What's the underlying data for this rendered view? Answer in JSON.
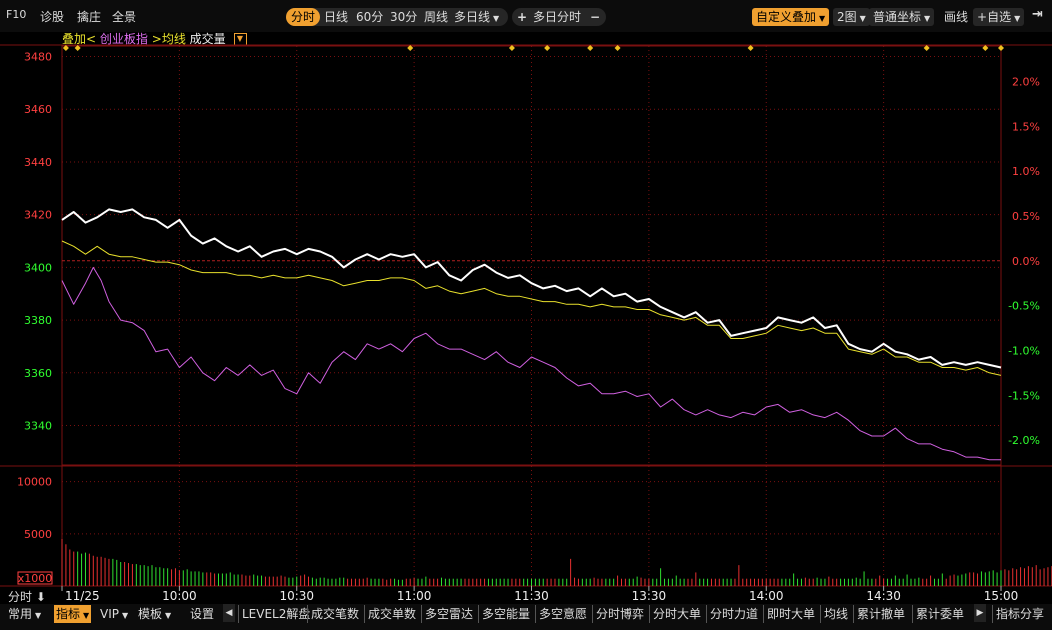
{
  "toolbar": {
    "left": [
      "F10",
      "诊股",
      "擒庄",
      "全景"
    ],
    "period_tabs": [
      "分时",
      "日线",
      "60分",
      "30分",
      "周线",
      "多日线"
    ],
    "multiday_label": "多日分时",
    "custom_overlay": "自定义叠加",
    "charts_count": "2图",
    "coord_mode": "普通坐标",
    "draw_label": "画线",
    "watchlist": "自选"
  },
  "overlay": {
    "label": "叠加",
    "open": "<",
    "index": "创业板指",
    "close": ">",
    "avg": "均线",
    "volume": "成交量"
  },
  "colors": {
    "bg": "#000000",
    "grid": "#7a1010",
    "price": "#ffffff",
    "avg": "#e8e02c",
    "overlay": "#d060e0",
    "up": "#ff4040",
    "down": "#30ff30",
    "active": "#f0a030"
  },
  "chart_data": {
    "type": "line",
    "left_ticks": [
      3480,
      3460,
      3440,
      3420,
      3400,
      3380,
      3360,
      3340
    ],
    "right_ticks": [
      "2.0%",
      "1.5%",
      "1.0%",
      "0.5%",
      "0.0%",
      "-0.5%",
      "-1.0%",
      "-1.5%",
      "-2.0%"
    ],
    "ylim": [
      3325,
      3484
    ],
    "base": 3402.5,
    "x_labels": [
      "11/25",
      "10:00",
      "10:30",
      "11:00",
      "11:30",
      "13:30",
      "14:00",
      "14:30",
      "15:00"
    ],
    "x_minutes": [
      0,
      30,
      60,
      90,
      120,
      150,
      180,
      210,
      240
    ],
    "markers": [
      1,
      4,
      89,
      115,
      124,
      135,
      142,
      176,
      221,
      236,
      240
    ],
    "series": [
      {
        "key": "price",
        "points": [
          [
            0,
            3418
          ],
          [
            3,
            3421
          ],
          [
            6,
            3417
          ],
          [
            9,
            3419
          ],
          [
            12,
            3422
          ],
          [
            15,
            3421
          ],
          [
            18,
            3422
          ],
          [
            21,
            3419
          ],
          [
            24,
            3418
          ],
          [
            27,
            3415
          ],
          [
            30,
            3418
          ],
          [
            33,
            3412
          ],
          [
            36,
            3409
          ],
          [
            39,
            3411
          ],
          [
            42,
            3408
          ],
          [
            45,
            3406
          ],
          [
            48,
            3408
          ],
          [
            51,
            3404
          ],
          [
            54,
            3406
          ],
          [
            57,
            3407
          ],
          [
            60,
            3405
          ],
          [
            63,
            3407
          ],
          [
            66,
            3406
          ],
          [
            69,
            3404
          ],
          [
            72,
            3400
          ],
          [
            75,
            3403
          ],
          [
            78,
            3405
          ],
          [
            81,
            3403
          ],
          [
            84,
            3405
          ],
          [
            87,
            3404
          ],
          [
            90,
            3405
          ],
          [
            93,
            3400
          ],
          [
            96,
            3402
          ],
          [
            99,
            3397
          ],
          [
            102,
            3395
          ],
          [
            105,
            3399
          ],
          [
            108,
            3401
          ],
          [
            111,
            3398
          ],
          [
            114,
            3396
          ],
          [
            117,
            3397
          ],
          [
            120,
            3394
          ],
          [
            123,
            3392
          ],
          [
            126,
            3393
          ],
          [
            129,
            3391
          ],
          [
            132,
            3392
          ],
          [
            135,
            3389
          ],
          [
            138,
            3392
          ],
          [
            141,
            3389
          ],
          [
            144,
            3390
          ],
          [
            147,
            3387
          ],
          [
            150,
            3388
          ],
          [
            153,
            3385
          ],
          [
            156,
            3383
          ],
          [
            159,
            3381
          ],
          [
            162,
            3383
          ],
          [
            165,
            3379
          ],
          [
            168,
            3380
          ],
          [
            171,
            3374
          ],
          [
            174,
            3375
          ],
          [
            177,
            3376
          ],
          [
            180,
            3377
          ],
          [
            183,
            3381
          ],
          [
            186,
            3380
          ],
          [
            189,
            3379
          ],
          [
            192,
            3381
          ],
          [
            195,
            3377
          ],
          [
            198,
            3378
          ],
          [
            201,
            3371
          ],
          [
            204,
            3369
          ],
          [
            207,
            3368
          ],
          [
            210,
            3371
          ],
          [
            213,
            3368
          ],
          [
            216,
            3367
          ],
          [
            219,
            3365
          ],
          [
            222,
            3366
          ],
          [
            225,
            3363
          ],
          [
            228,
            3364
          ],
          [
            231,
            3363
          ],
          [
            234,
            3364
          ],
          [
            237,
            3363
          ],
          [
            240,
            3362
          ]
        ]
      },
      {
        "key": "avg",
        "points": [
          [
            0,
            3410
          ],
          [
            3,
            3408
          ],
          [
            6,
            3405
          ],
          [
            9,
            3408
          ],
          [
            12,
            3405
          ],
          [
            15,
            3404
          ],
          [
            18,
            3404
          ],
          [
            21,
            3403
          ],
          [
            24,
            3402
          ],
          [
            27,
            3402
          ],
          [
            30,
            3401
          ],
          [
            33,
            3399
          ],
          [
            36,
            3398
          ],
          [
            39,
            3398
          ],
          [
            42,
            3398
          ],
          [
            45,
            3397
          ],
          [
            48,
            3397
          ],
          [
            51,
            3396
          ],
          [
            54,
            3397
          ],
          [
            57,
            3396
          ],
          [
            60,
            3396
          ],
          [
            63,
            3397
          ],
          [
            66,
            3396
          ],
          [
            69,
            3395
          ],
          [
            72,
            3393
          ],
          [
            75,
            3394
          ],
          [
            78,
            3395
          ],
          [
            81,
            3395
          ],
          [
            84,
            3396
          ],
          [
            87,
            3396
          ],
          [
            90,
            3395
          ],
          [
            93,
            3392
          ],
          [
            96,
            3393
          ],
          [
            99,
            3391
          ],
          [
            102,
            3390
          ],
          [
            105,
            3391
          ],
          [
            108,
            3392
          ],
          [
            111,
            3390
          ],
          [
            114,
            3389
          ],
          [
            117,
            3389
          ],
          [
            120,
            3388
          ],
          [
            123,
            3387
          ],
          [
            126,
            3387
          ],
          [
            129,
            3386
          ],
          [
            132,
            3386
          ],
          [
            135,
            3385
          ],
          [
            138,
            3386
          ],
          [
            141,
            3385
          ],
          [
            144,
            3385
          ],
          [
            147,
            3384
          ],
          [
            150,
            3384
          ],
          [
            153,
            3382
          ],
          [
            156,
            3381
          ],
          [
            159,
            3380
          ],
          [
            162,
            3381
          ],
          [
            165,
            3378
          ],
          [
            168,
            3378
          ],
          [
            171,
            3373
          ],
          [
            174,
            3373
          ],
          [
            177,
            3374
          ],
          [
            180,
            3375
          ],
          [
            183,
            3378
          ],
          [
            186,
            3377
          ],
          [
            189,
            3376
          ],
          [
            192,
            3377
          ],
          [
            195,
            3375
          ],
          [
            198,
            3375
          ],
          [
            201,
            3369
          ],
          [
            204,
            3368
          ],
          [
            207,
            3367
          ],
          [
            210,
            3369
          ],
          [
            213,
            3366
          ],
          [
            216,
            3366
          ],
          [
            219,
            3364
          ],
          [
            222,
            3364
          ],
          [
            225,
            3362
          ],
          [
            228,
            3362
          ],
          [
            231,
            3361
          ],
          [
            234,
            3362
          ],
          [
            237,
            3360
          ],
          [
            240,
            3359
          ]
        ]
      },
      {
        "key": "overlay",
        "points": [
          [
            0,
            3395
          ],
          [
            3,
            3386
          ],
          [
            6,
            3394
          ],
          [
            8,
            3400
          ],
          [
            10,
            3395
          ],
          [
            12,
            3387
          ],
          [
            15,
            3380
          ],
          [
            18,
            3379
          ],
          [
            21,
            3376
          ],
          [
            24,
            3368
          ],
          [
            27,
            3369
          ],
          [
            30,
            3362
          ],
          [
            33,
            3366
          ],
          [
            36,
            3360
          ],
          [
            39,
            3357
          ],
          [
            42,
            3362
          ],
          [
            45,
            3359
          ],
          [
            48,
            3363
          ],
          [
            51,
            3359
          ],
          [
            54,
            3361
          ],
          [
            57,
            3354
          ],
          [
            60,
            3352
          ],
          [
            63,
            3360
          ],
          [
            66,
            3356
          ],
          [
            69,
            3364
          ],
          [
            72,
            3368
          ],
          [
            75,
            3365
          ],
          [
            78,
            3371
          ],
          [
            81,
            3369
          ],
          [
            84,
            3371
          ],
          [
            87,
            3368
          ],
          [
            90,
            3373
          ],
          [
            93,
            3375
          ],
          [
            96,
            3371
          ],
          [
            99,
            3369
          ],
          [
            102,
            3369
          ],
          [
            105,
            3367
          ],
          [
            108,
            3365
          ],
          [
            111,
            3368
          ],
          [
            114,
            3364
          ],
          [
            117,
            3362
          ],
          [
            120,
            3366
          ],
          [
            123,
            3364
          ],
          [
            126,
            3362
          ],
          [
            129,
            3358
          ],
          [
            132,
            3355
          ],
          [
            135,
            3356
          ],
          [
            138,
            3352
          ],
          [
            141,
            3352
          ],
          [
            144,
            3353
          ],
          [
            147,
            3351
          ],
          [
            150,
            3352
          ],
          [
            153,
            3347
          ],
          [
            156,
            3350
          ],
          [
            159,
            3346
          ],
          [
            162,
            3344
          ],
          [
            165,
            3346
          ],
          [
            168,
            3344
          ],
          [
            171,
            3343
          ],
          [
            174,
            3345
          ],
          [
            177,
            3344
          ],
          [
            180,
            3347
          ],
          [
            183,
            3348
          ],
          [
            186,
            3345
          ],
          [
            189,
            3346
          ],
          [
            192,
            3344
          ],
          [
            195,
            3343
          ],
          [
            198,
            3345
          ],
          [
            201,
            3342
          ],
          [
            204,
            3338
          ],
          [
            207,
            3336
          ],
          [
            210,
            3336
          ],
          [
            213,
            3339
          ],
          [
            216,
            3335
          ],
          [
            219,
            3333
          ],
          [
            222,
            3333
          ],
          [
            225,
            3331
          ],
          [
            228,
            3330
          ],
          [
            231,
            3328
          ],
          [
            234,
            3328
          ],
          [
            237,
            3327
          ],
          [
            240,
            3327
          ]
        ]
      }
    ],
    "volume": {
      "ticks": [
        10000,
        5000
      ],
      "ylim": [
        0,
        11500
      ],
      "unit": "x1000",
      "values": [
        4500,
        4000,
        3500,
        3300,
        3300,
        3100,
        3200,
        3100,
        2900,
        2800,
        2800,
        2700,
        2600,
        2600,
        2500,
        2300,
        2300,
        2200,
        2100,
        2100,
        2000,
        2000,
        1900,
        2000,
        1800,
        1800,
        1700,
        1700,
        1600,
        1700,
        1500,
        1500,
        1600,
        1400,
        1400,
        1400,
        1300,
        1300,
        1300,
        1200,
        1200,
        1200,
        1200,
        1300,
        1100,
        1100,
        1100,
        1000,
        1000,
        1100,
        1000,
        1000,
        900,
        900,
        900,
        900,
        1000,
        900,
        800,
        800,
        900,
        1000,
        1100,
        900,
        800,
        700,
        800,
        800,
        700,
        700,
        700,
        800,
        800,
        700,
        700,
        700,
        700,
        700,
        800,
        700,
        700,
        700,
        700,
        600,
        700,
        700,
        600,
        600,
        700,
        700,
        800,
        700,
        700,
        900,
        700,
        700,
        700,
        800,
        700,
        700,
        700,
        700,
        700,
        700,
        700,
        700,
        700,
        700,
        700,
        700,
        700,
        700,
        700,
        700,
        700,
        700,
        700,
        700,
        700,
        700,
        700,
        700,
        700,
        700,
        700,
        700,
        700,
        700,
        700,
        700,
        2600,
        800,
        700,
        700,
        700,
        700,
        800,
        700,
        700,
        700,
        700,
        700,
        1000,
        700,
        700,
        700,
        700,
        900,
        800,
        700,
        700,
        700,
        700,
        1700,
        700,
        700,
        700,
        1000,
        700,
        700,
        700,
        700,
        1300,
        700,
        700,
        700,
        700,
        700,
        700,
        700,
        700,
        700,
        700,
        2000,
        700,
        700,
        700,
        700,
        700,
        700,
        700,
        700,
        700,
        700,
        700,
        700,
        700,
        1200,
        700,
        700,
        800,
        700,
        700,
        800,
        700,
        700,
        900,
        700,
        700,
        700,
        700,
        700,
        700,
        800,
        700,
        1400,
        700,
        700,
        700,
        1000,
        700,
        700,
        700,
        1000,
        700,
        700,
        1100,
        700,
        700,
        800,
        700,
        700,
        1000,
        700,
        700,
        1200,
        700,
        1000,
        1100,
        1000,
        1100,
        1200,
        1300,
        1300,
        1200,
        1400,
        1300,
        1400,
        1500,
        1300,
        1500,
        1600,
        1500,
        1700,
        1600,
        1800,
        1700,
        1900,
        1800,
        2000,
        1600,
        1700,
        1800,
        1900,
        3800
      ]
    }
  },
  "bottom": {
    "period": "分时",
    "tabs": [
      "常用",
      "指标",
      "VIP",
      "模板",
      "设置"
    ],
    "indicators": [
      "LEVEL2解盘",
      "成交笔数",
      "成交单数",
      "多空雷达",
      "多空能量",
      "多空意愿",
      "分时博弈",
      "分时大单",
      "分时力道",
      "即时大单",
      "均线",
      "累计撤单",
      "累计委单",
      "指标分享"
    ]
  }
}
